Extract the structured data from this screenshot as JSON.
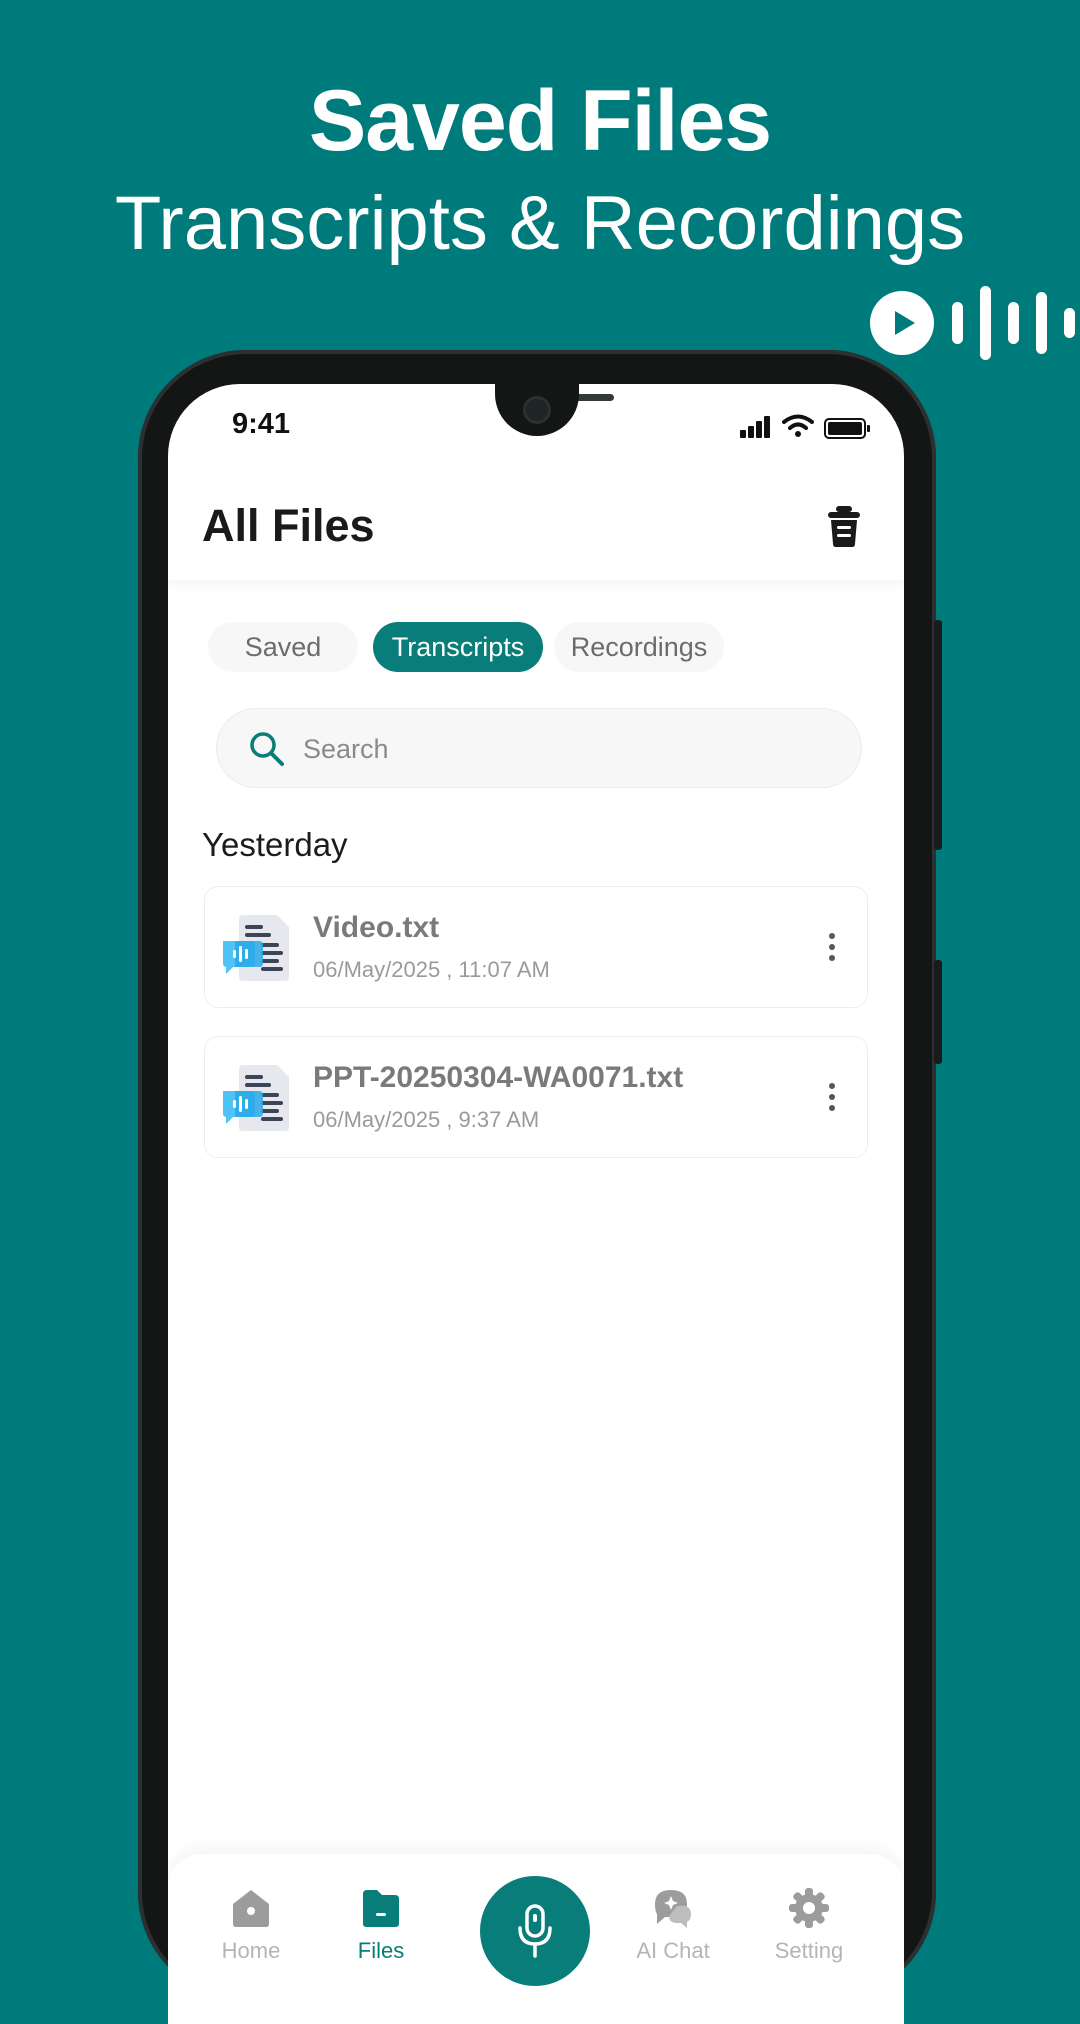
{
  "promo": {
    "title": "Saved Files",
    "subtitle": "Transcripts & Recordings"
  },
  "status_bar": {
    "time": "9:41"
  },
  "header": {
    "title": "All Files"
  },
  "tabs": [
    {
      "label": "Saved",
      "active": false
    },
    {
      "label": "Transcripts",
      "active": true
    },
    {
      "label": "Recordings",
      "active": false
    }
  ],
  "search": {
    "placeholder": "Search",
    "value": ""
  },
  "section": {
    "label": "Yesterday"
  },
  "files": [
    {
      "name": "Video.txt",
      "date": "06/May/2025 , 11:07 AM"
    },
    {
      "name": "PPT-20250304-WA0071.txt",
      "date": "06/May/2025 , 9:37 AM"
    }
  ],
  "bottom_nav": [
    {
      "label": "Home",
      "icon": "home-icon"
    },
    {
      "label": "Files",
      "icon": "files-icon",
      "active": true
    },
    {
      "label": "",
      "icon": "mic-icon"
    },
    {
      "label": "AI Chat",
      "icon": "ai-chat-icon"
    },
    {
      "label": "Setting",
      "icon": "settings-icon"
    }
  ],
  "colors": {
    "background": "#007b7b",
    "accent": "#087d79"
  }
}
